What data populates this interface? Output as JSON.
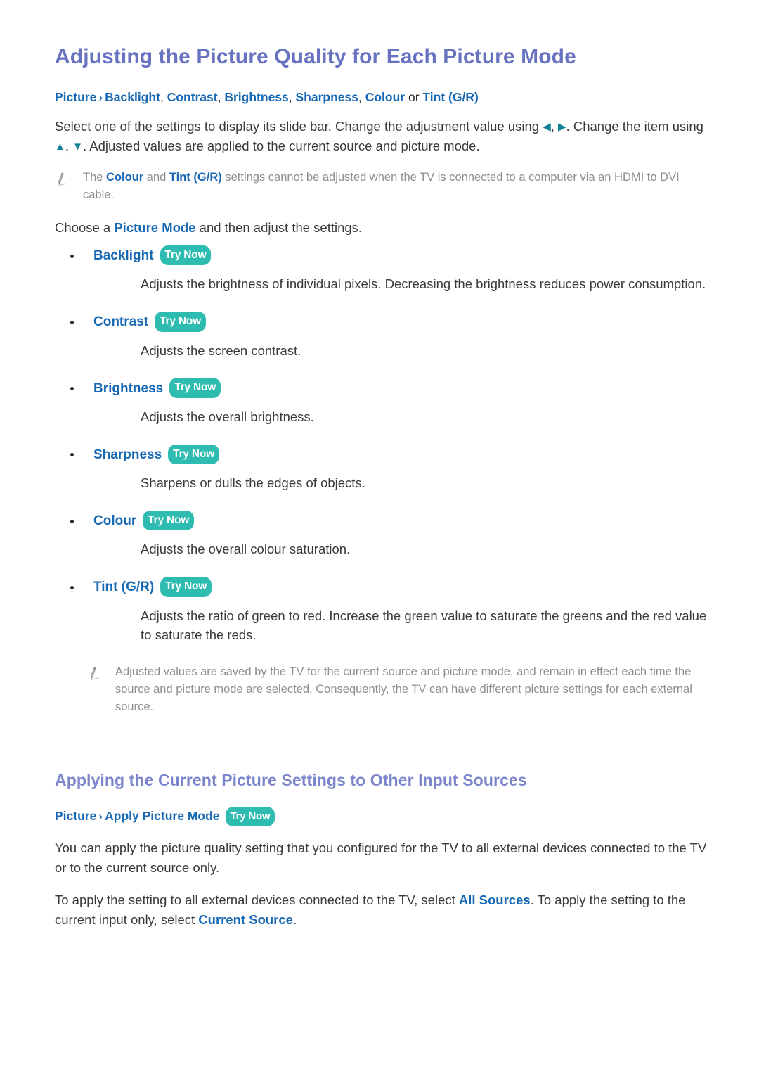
{
  "colors": {
    "heading_primary": "#6773c0",
    "heading_secondary": "#7b85cb",
    "link_blue": "#1869b4",
    "try_now_teal": "#2fbcb0",
    "arrow_teal": "#0f8395",
    "body_text": "#3a3a3a",
    "note_text": "#8e8e8e"
  },
  "badges": {
    "try_now": "Try Now"
  },
  "icons": {
    "note": "pencil-icon",
    "bullet": "bullet-dot-icon"
  },
  "section1": {
    "heading": "Adjusting the Picture Quality for Each Picture Mode",
    "breadcrumb": {
      "root": "Picture",
      "separator": "›",
      "items": [
        "Backlight",
        "Contrast",
        "Brightness",
        "Sharpness",
        "Colour"
      ],
      "conjunction": "or",
      "last_item": "Tint (G/R)"
    },
    "intro_part1": "Select one of the settings to display its slide bar. Change the adjustment value using ",
    "intro_arrow_left": "◀",
    "intro_arrow_comma": ", ",
    "intro_arrow_right": "▶",
    "intro_part2": ". Change the item using ",
    "intro_arrow_up": "▲",
    "intro_arrow_down": "▼",
    "intro_part3": ". Adjusted values are applied to the current source and picture mode.",
    "note1_part1": "The ",
    "note1_term1": "Colour",
    "note1_part2": " and ",
    "note1_term2": "Tint (G/R)",
    "note1_part3": " settings cannot be adjusted when the TV is connected to a computer via an HDMI to DVI cable.",
    "choose_part1": "Choose a ",
    "choose_term": "Picture Mode",
    "choose_part2": " and then adjust the settings.",
    "items": [
      {
        "label": "Backlight",
        "description": "Adjusts the brightness of individual pixels. Decreasing the brightness reduces power consumption."
      },
      {
        "label": "Contrast",
        "description": "Adjusts the screen contrast."
      },
      {
        "label": "Brightness",
        "description": "Adjusts the overall brightness."
      },
      {
        "label": "Sharpness",
        "description": "Sharpens or dulls the edges of objects."
      },
      {
        "label": "Colour",
        "description": "Adjusts the overall colour saturation."
      },
      {
        "label": "Tint (G/R)",
        "description": "Adjusts the ratio of green to red. Increase the green value to saturate the greens and the red value to saturate the reds."
      }
    ],
    "note2": "Adjusted values are saved by the TV for the current source and picture mode, and remain in effect each time the source and picture mode are selected. Consequently, the TV can have different picture settings for each external source."
  },
  "section2": {
    "heading": "Applying the Current Picture Settings to Other Input Sources",
    "breadcrumb": {
      "root": "Picture",
      "separator": "›",
      "item": "Apply Picture Mode"
    },
    "paragraph1": "You can apply the picture quality setting that you configured for the TV to all external devices connected to the TV or to the current source only.",
    "paragraph2_part1": "To apply the setting to all external devices connected to the TV, select ",
    "paragraph2_term1": "All Sources",
    "paragraph2_part2": ". To apply the setting to the current input only, select ",
    "paragraph2_term2": "Current Source",
    "paragraph2_part3": "."
  }
}
